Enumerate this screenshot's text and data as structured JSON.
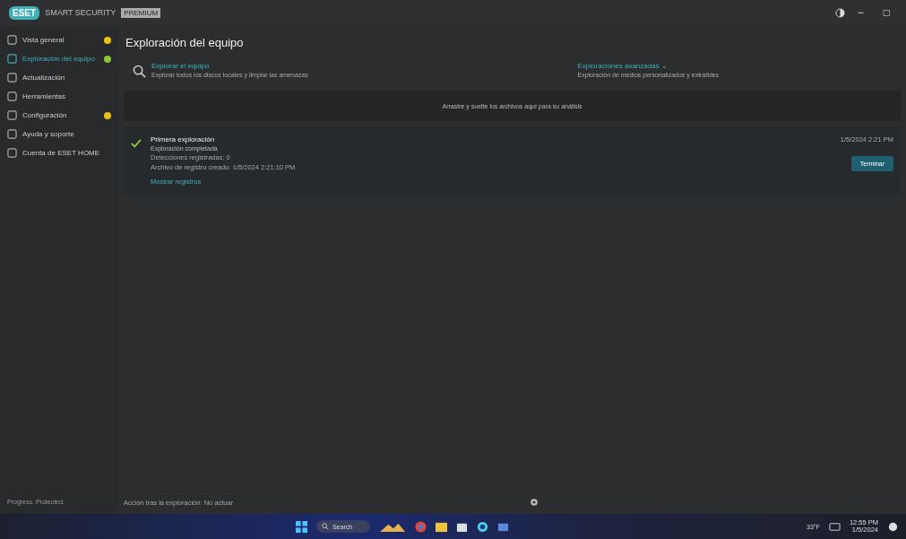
{
  "window": {
    "logo": "ESET",
    "product": "SMART SECURITY",
    "edition": "PREMIUM",
    "controls": [
      "−",
      "□"
    ]
  },
  "sidebar": {
    "items": [
      {
        "label": "Vista general",
        "selected": false,
        "color": "#e8c21a"
      },
      {
        "label": "Exploración del equipo",
        "selected": true,
        "color": "#8cc63f"
      },
      {
        "label": "Actualización",
        "selected": false
      },
      {
        "label": "Herramientas",
        "selected": false
      },
      {
        "label": "Configuración",
        "selected": false,
        "color": "#e8c21a"
      },
      {
        "label": "Ayuda y soporte",
        "selected": false
      },
      {
        "label": "Cuenta de ESET HOME",
        "selected": false
      }
    ],
    "footer": "Progress. Protected."
  },
  "page": {
    "title": "Exploración del equipo",
    "actions": [
      {
        "title": "Explorar el equipo",
        "subtitle": "Explorar todos los discos locales y limpiar las amenazas"
      },
      {
        "title": "Exploraciones avanzadas ⌄",
        "subtitle": "Exploración de medios personalizados y extraíbles"
      }
    ],
    "drop_hint": "Arrastre y suelte los archivos aquí para su análisis",
    "scan": {
      "title": "Primera exploración",
      "status": "Exploración completada",
      "lines": [
        "Detecciones registradas: 0",
        "Archivo de registro creado: 1/5/2024 2:21:10 PM"
      ],
      "link": "Mostrar registros",
      "date": "1/5/2024 2:21 PM",
      "button": "Terminar",
      "done": true
    },
    "after_scan": "Acción tras la exploración: No actuar"
  },
  "taskbar": {
    "search": "Search",
    "weather": "33°F",
    "clock": [
      "12:55 PM",
      "1/5/2024"
    ]
  }
}
